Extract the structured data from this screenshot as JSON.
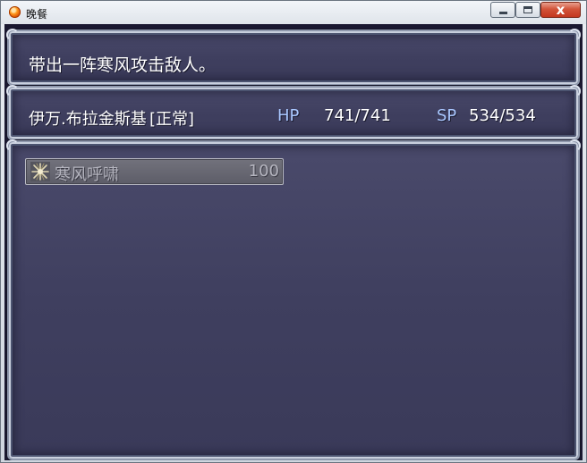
{
  "window": {
    "title": "晚餐",
    "icon": "orange-orb-icon",
    "close_glyph": "x"
  },
  "help": {
    "text": "带出一阵寒风攻击敌人。"
  },
  "status": {
    "actor_name": "伊万.布拉金斯基",
    "state": "[正常]",
    "hp_label": "HP",
    "hp_value": "741/741",
    "sp_label": "SP",
    "sp_value": "534/534"
  },
  "skills": {
    "items": [
      {
        "icon": "wind-burst-icon",
        "name": "寒风呼啸",
        "cost": "100"
      }
    ]
  },
  "colors": {
    "panel_bg": "#3f3f5f",
    "label_blue": "#a9c7ff",
    "disabled_text": "#b5b5bf"
  }
}
